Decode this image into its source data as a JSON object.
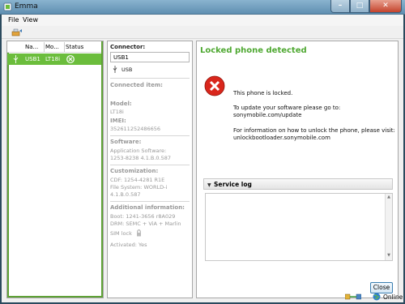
{
  "window": {
    "title": "Emma",
    "minimize_icon": "minimize-icon",
    "maximize_icon": "maximize-icon",
    "close_icon": "close-icon"
  },
  "menu": {
    "items": [
      "File",
      "View"
    ]
  },
  "toolbar": {
    "tool_icon": "device-toolbar-icon"
  },
  "device_list": {
    "columns": [
      "Na...",
      "Mo...",
      "Status"
    ],
    "rows": [
      {
        "name": "USB1",
        "model": "LT18i",
        "status_icon": "x-circle-icon"
      }
    ]
  },
  "details": {
    "connector_label": "Connector:",
    "connector_value": "USB1",
    "connector_type": "USB",
    "connected_item_label": "Connected item:",
    "model_label": "Model:",
    "model_value": "LT18i",
    "imei_label": "IMEI:",
    "imei_value": "352611252486656",
    "software_label": "Software:",
    "software_line1": "Application Software:",
    "software_line2": "1253-8238 4.1.B.0.587",
    "customization_label": "Customization:",
    "customization_line1": "CDF: 1254-4281 R1E",
    "customization_line2": "File System: WORLD-i",
    "customization_line3": "4.1.B.0.587",
    "additional_label": "Additional information:",
    "additional_line1": "Boot: 1241-3656 r8A029",
    "additional_line2": "DRM: SEMC + ViA + Marlin",
    "sim_lock": "SIM lock",
    "activated": "Activated: Yes"
  },
  "main": {
    "title": "Locked phone detected",
    "msg1": "This phone is locked.",
    "msg2a": "To update your software please go to:",
    "msg2b": "sonymobile.com/update",
    "msg3a": "For information on how to unlock the phone, please visit:",
    "msg3b": "unlockbootloader.sonymobile.com",
    "service_log_label": "Service log",
    "close_label": "Close"
  },
  "status": {
    "online": "Online"
  },
  "colors": {
    "accent_green": "#4fa832",
    "selection_green": "#6bbd3c",
    "error_red": "#d9261c"
  }
}
